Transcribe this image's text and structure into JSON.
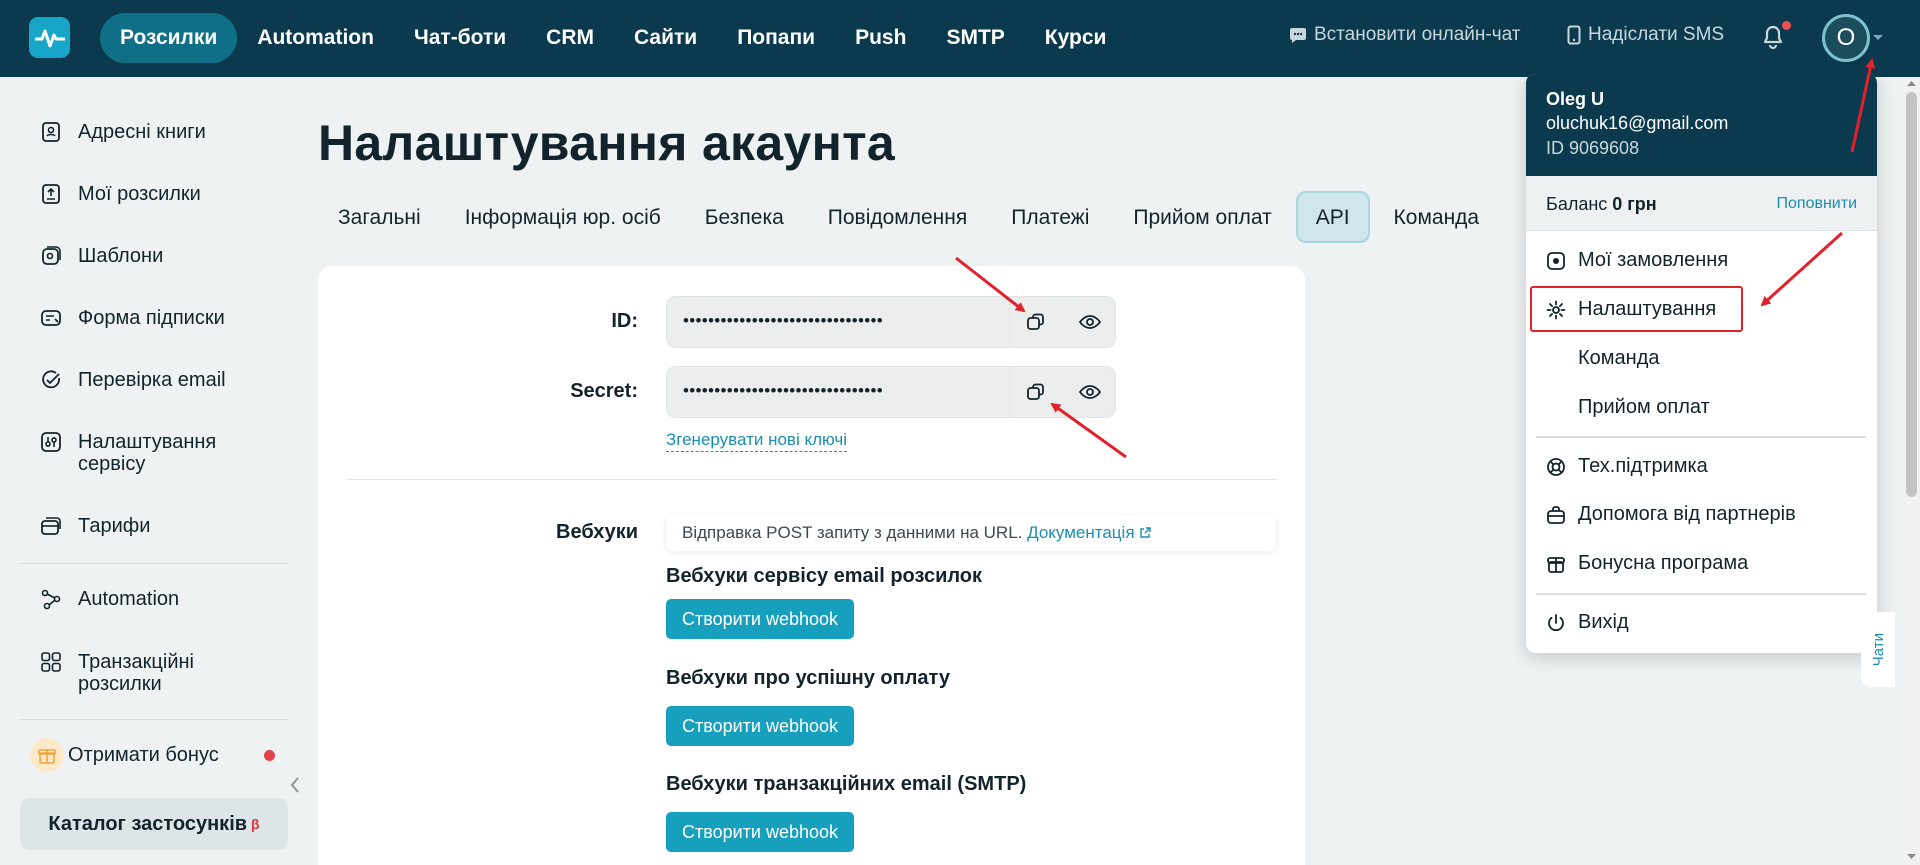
{
  "nav": {
    "items": [
      "Розсилки",
      "Automation",
      "Чат-боти",
      "CRM",
      "Сайти",
      "Попапи",
      "Push",
      "SMTP",
      "Курси"
    ],
    "active_index": 0
  },
  "topbar": {
    "online_chat": "Встановити онлайн-чат",
    "send_sms": "Надіслати SMS",
    "avatar_letter": "O"
  },
  "sidebar": {
    "address_books": "Адресні книги",
    "my_campaigns": "Мої розсилки",
    "templates": "Шаблони",
    "subscribe_form": "Форма підписки",
    "email_check": "Перевірка email",
    "service_settings": "Налаштування сервісу",
    "tariffs": "Тарифи",
    "automation": "Automation",
    "transactional": "Транзакційні розсилки",
    "get_bonus": "Отримати бонус",
    "catalog": "Каталог застосунків",
    "catalog_badge": "β"
  },
  "page": {
    "title": "Налаштування акаунта",
    "tabs": [
      "Загальні",
      "Інформація юр. осіб",
      "Безпека",
      "Повідомлення",
      "Платежі",
      "Прийом оплат",
      "API",
      "Команда"
    ],
    "active_tab_index": 6
  },
  "api": {
    "id_label": "ID:",
    "id_value": "••••••••••••••••••••••••••••••••",
    "secret_label": "Secret:",
    "secret_value": "••••••••••••••••••••••••••••••••",
    "generate_link": "Згенерувати нові ключі"
  },
  "webhooks": {
    "label": "Вебхуки",
    "note_text": "Відправка POST запиту з данними на URL.",
    "doc_link": "Документація",
    "sections": [
      {
        "title": "Вебхуки сервісу email розсилок",
        "button": "Створити webhook"
      },
      {
        "title": "Вебхуки про успішну оплату",
        "button": "Створити webhook"
      },
      {
        "title": "Вебхуки транзакційних email (SMTP)",
        "button": "Створити webhook"
      }
    ]
  },
  "account_menu": {
    "name": "Oleg U",
    "email": "oluchuk16@gmail.com",
    "id": "ID 9069608",
    "balance_label": "Баланс",
    "balance_value": "0 грн",
    "topup": "Поповнити",
    "my_orders": "Мої замовлення",
    "settings": "Налаштування",
    "team": "Команда",
    "payments": "Прийом оплат",
    "support": "Тех.підтримка",
    "partners": "Допомога від партнерів",
    "bonus_program": "Бонусна програма",
    "logout": "Вихід"
  },
  "chats_tab": "Чати",
  "colors": {
    "topbar": "#0b3a4e",
    "accent": "#17a0bd",
    "link": "#1b8fb0",
    "annotation": "#e1222b"
  }
}
